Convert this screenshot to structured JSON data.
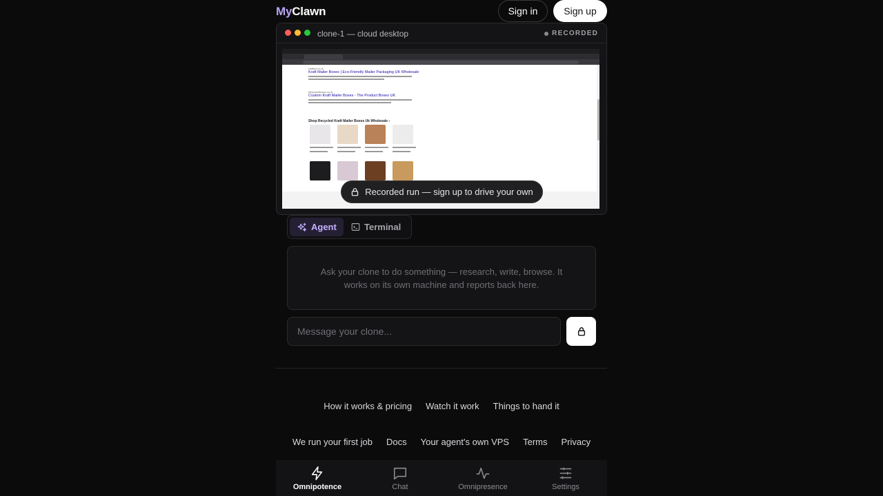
{
  "header": {
    "logo_my": "My",
    "logo_clawn": "Clawn",
    "signin_label": "Sign in",
    "signup_label": "Sign up"
  },
  "desktop": {
    "title": "clone-1 — cloud desktop",
    "status": "RECORDED",
    "toast": "Recorded run — sign up to drive your own",
    "screen": {
      "result1_site": "kraftbox.co.uk",
      "result1_title": "Kraft Mailer Boxes | Eco-Friendly Mailer Packaging UK Wholesale",
      "result2_site": "theproductboxes.co.uk",
      "result2_title": "Custom Kraft Mailer Boxes - The Product Boxes UK",
      "shop_title": "Shop Recycled Kraft Mailer Boxes Uk Wholesale ›"
    }
  },
  "tabs": {
    "agent": "Agent",
    "terminal": "Terminal",
    "active": "agent"
  },
  "chat": {
    "empty_text": "Ask your clone to do something — research, write, browse. It works on its own machine and reports back here.",
    "input_placeholder": "Message your clone..."
  },
  "footer_links_row1": [
    "How it works & pricing",
    "Watch it work",
    "Things to hand it"
  ],
  "footer_links_row2": [
    "We run your first job",
    "Docs",
    "Your agent's own VPS",
    "Terms",
    "Privacy"
  ],
  "bottom_nav": [
    {
      "label": "Omnipotence",
      "icon": "bolt-icon",
      "active": true
    },
    {
      "label": "Chat",
      "icon": "chat-bubble-icon",
      "active": false
    },
    {
      "label": "Omnipresence",
      "icon": "activity-icon",
      "active": false
    },
    {
      "label": "Settings",
      "icon": "sliders-icon",
      "active": false
    }
  ],
  "colors": {
    "background": "#0b0b0c",
    "accent": "#b9a4f5",
    "agent_tab_bg": "#241f33"
  }
}
